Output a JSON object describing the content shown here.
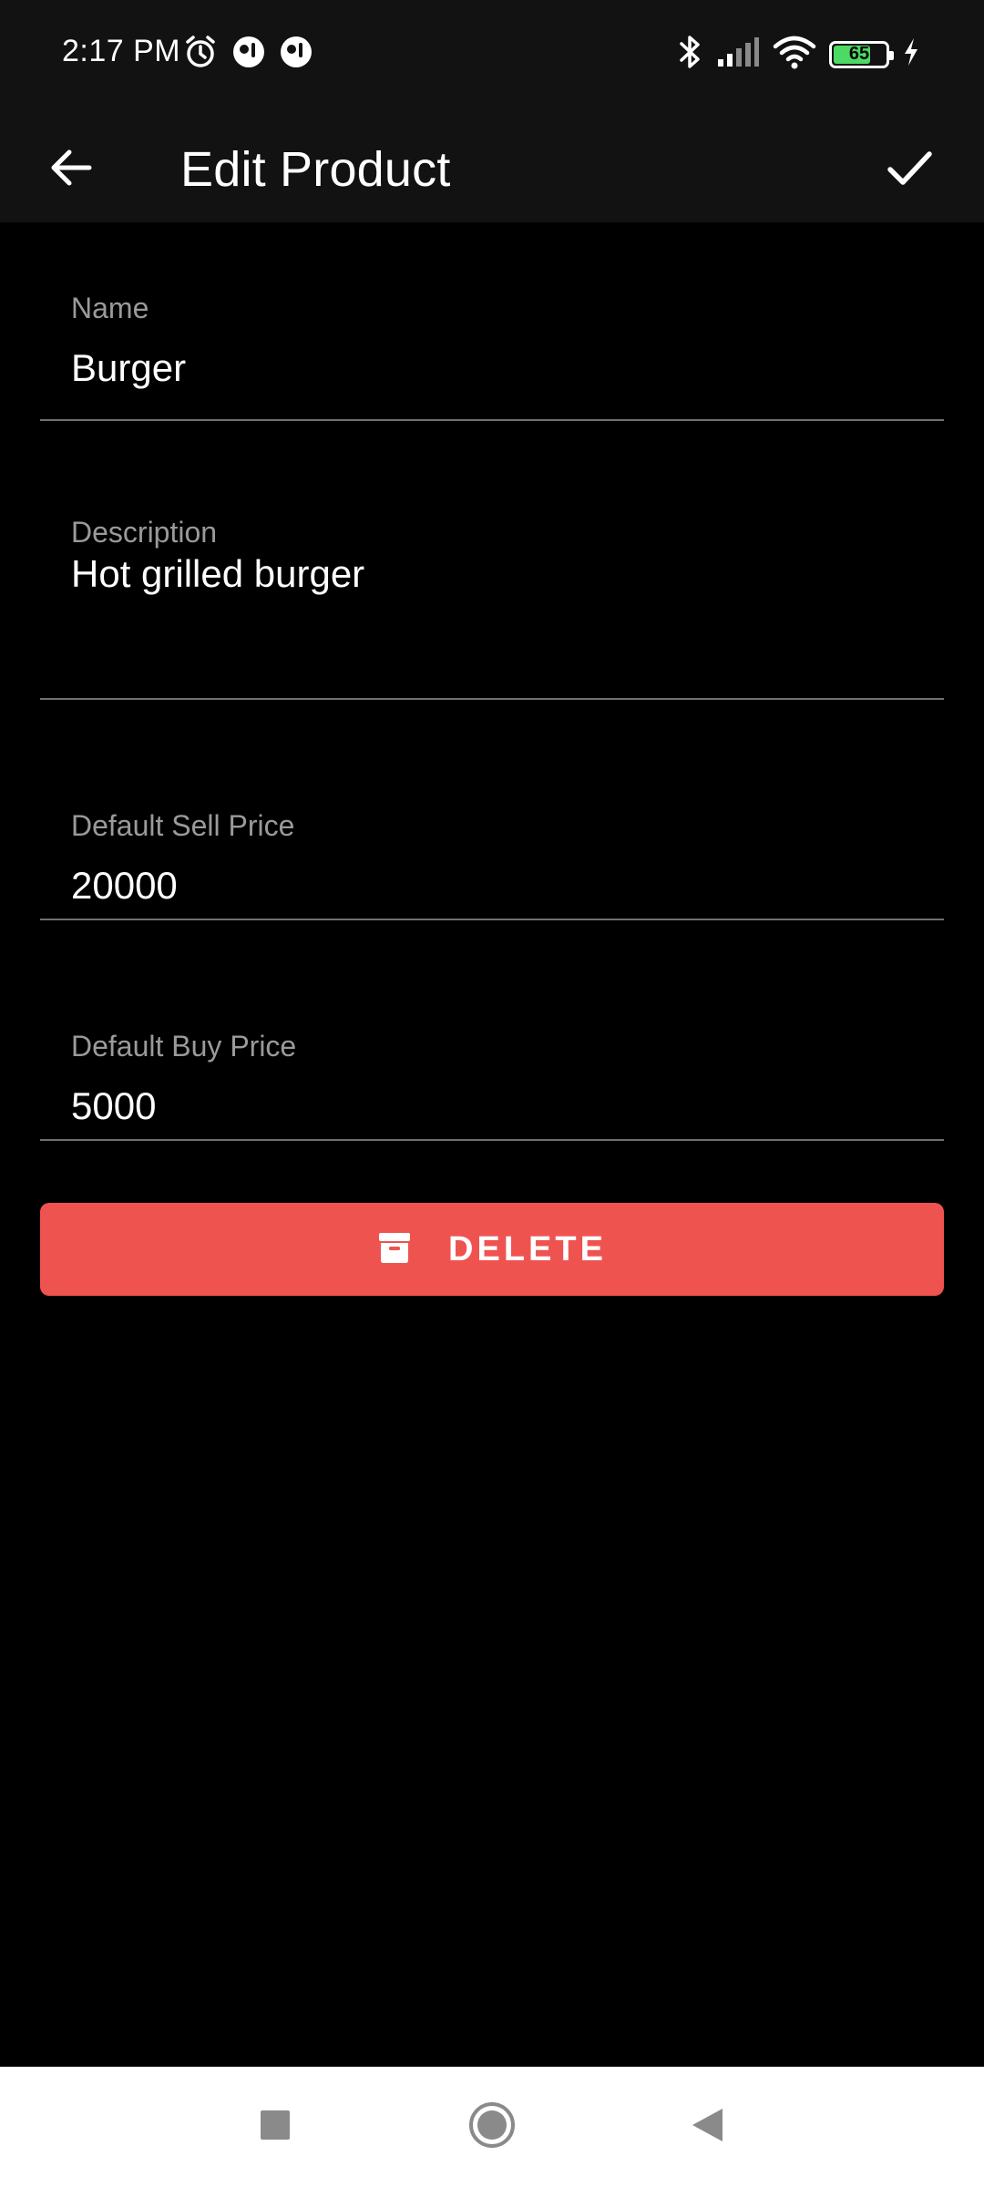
{
  "status_bar": {
    "time": "2:17 PM",
    "battery_level": "65",
    "icons_left": [
      "alarm-icon",
      "app-notification-icon",
      "app-notification-icon"
    ],
    "icons_right": [
      "bluetooth-icon",
      "signal-icon",
      "wifi-icon",
      "battery-icon",
      "charging-icon"
    ]
  },
  "app_bar": {
    "title": "Edit Product",
    "back_icon": "arrow-left-icon",
    "save_icon": "check-icon"
  },
  "form": {
    "name": {
      "label": "Name",
      "value": "Burger"
    },
    "description": {
      "label": "Description",
      "value": "Hot grilled burger"
    },
    "sell_price": {
      "label": "Default Sell Price",
      "value": "20000"
    },
    "buy_price": {
      "label": "Default Buy Price",
      "value": "5000"
    }
  },
  "delete_button": {
    "label": "DELETE",
    "icon": "archive-icon",
    "color": "#ef5350"
  },
  "nav_bar": {
    "buttons": [
      "recents-square-icon",
      "home-circle-icon",
      "back-triangle-icon"
    ]
  },
  "colors": {
    "background": "#000000",
    "app_bar": "#121212",
    "accent_delete": "#ef5350",
    "label": "#9a9a9a",
    "underline": "#6f6f6f"
  }
}
